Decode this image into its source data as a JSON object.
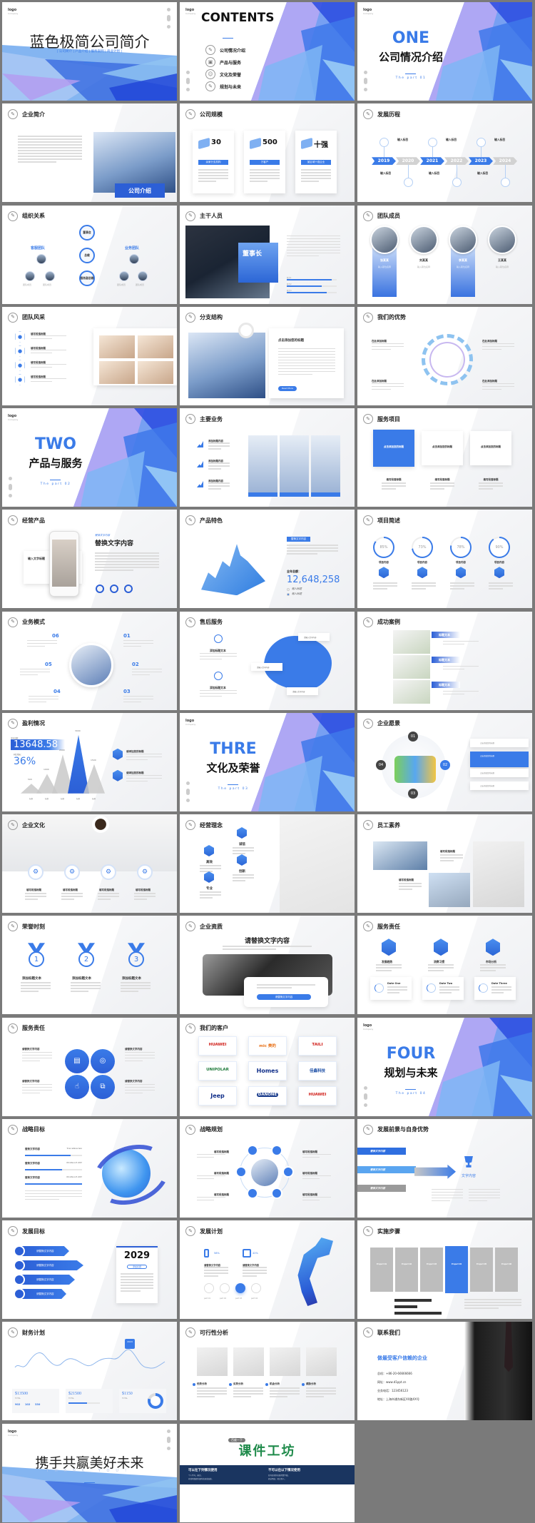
{
  "colors": {
    "accent": "#3a7be8",
    "accent_dark": "#2c5fd6",
    "bg": "#7a7a7a",
    "navy": "#1a3560",
    "green_title": "#1e8a4a"
  },
  "logo": {
    "text": "logo",
    "sub": "Company"
  },
  "slides": [
    {
      "type": "cover",
      "title": "蓝色极简公司简介",
      "subtitle": "| 公司简介 | 产品介绍 | 服务案例 | 商业计划 |"
    },
    {
      "type": "contents",
      "title": "CONTENTS",
      "items": [
        {
          "icon": "pencil-icon",
          "label": "公司情况介绍"
        },
        {
          "icon": "box-icon",
          "label": "产品与服务"
        },
        {
          "icon": "person-icon",
          "label": "文化及荣誉"
        },
        {
          "icon": "pencil-icon",
          "label": "规划与未来"
        }
      ]
    },
    {
      "type": "section",
      "num": "ONE",
      "title": "公司情况介绍",
      "part": "The part 01"
    },
    {
      "type": "intro",
      "header": "企业简介",
      "photo_label": "公司介绍"
    },
    {
      "type": "scale",
      "header": "公司规模",
      "cards": [
        {
          "value": "30",
          "label": "余家分支机构"
        },
        {
          "value": "500",
          "label": "万客户"
        },
        {
          "value": "十强",
          "label": "某区域十强企业"
        }
      ]
    },
    {
      "type": "timeline",
      "header": "发展历程",
      "years": [
        "2019",
        "2020",
        "2021",
        "2022",
        "2023",
        "2024"
      ],
      "item_label": "输入标目",
      "active": [
        true,
        false,
        true,
        false,
        true,
        false
      ]
    },
    {
      "type": "org",
      "header": "组织关系",
      "center": [
        "董事会",
        "总裁",
        "服务副总裁"
      ],
      "left_group": "客服团队",
      "right_group": "业务团队",
      "member": "团队成员"
    },
    {
      "type": "leader",
      "header": "主干人员",
      "role": "董事长",
      "bars": [
        {
          "label": "能力1",
          "value": 90
        },
        {
          "label": "能力2",
          "value": 70
        },
        {
          "label": "能力3",
          "value": 80
        }
      ]
    },
    {
      "type": "team",
      "header": "团队成员",
      "members": [
        {
          "name": "张某某",
          "role": "输入职位名称",
          "highlight": true
        },
        {
          "name": "刘某某",
          "role": "输入职位名称",
          "highlight": false
        },
        {
          "name": "李某某",
          "role": "输入职位名称",
          "highlight": true
        },
        {
          "name": "王某某",
          "role": "输入职位名称",
          "highlight": false
        }
      ]
    },
    {
      "type": "style",
      "header": "团队风采",
      "items": [
        "填写段落标题",
        "填写段落标题",
        "填写段落标题",
        "填写段落标题"
      ]
    },
    {
      "type": "branch",
      "header": "分支结构",
      "card_title": "点击添加您的标题",
      "button": "Read More"
    },
    {
      "type": "advantage",
      "header": "我们的优势",
      "items": [
        "在此添加标题",
        "在此添加标题",
        "在此添加标题",
        "在此添加标题"
      ]
    },
    {
      "type": "section",
      "num": "TWO",
      "title": "产品与服务",
      "part": "The part 02"
    },
    {
      "type": "business",
      "header": "主要业务",
      "items": [
        "添加标题内容",
        "添加标题内容",
        "添加标题内容"
      ]
    },
    {
      "type": "services",
      "header": "服务项目",
      "cards": [
        "点击添加您的标题",
        "点击添加您的标题",
        "点击添加您的标题"
      ],
      "bottom": [
        "填写段落标题",
        "填写段落标题",
        "填写段落标题"
      ]
    },
    {
      "type": "product",
      "header": "经营产品",
      "side_title": "输入文字标题",
      "kicker": "替换文字内容",
      "title": "替换文字内容"
    },
    {
      "type": "feature",
      "header": "产品特色",
      "tag": "替换文字内容",
      "total_label": "全年总额：",
      "total": "12,648,258",
      "legend": [
        "输入标题",
        "输入标题"
      ]
    },
    {
      "type": "project",
      "header": "项目简述",
      "rings": [
        {
          "value": 85,
          "label": "项目内容"
        },
        {
          "value": 73,
          "label": "项目内容"
        },
        {
          "value": 78,
          "label": "项目内容"
        },
        {
          "value": 90,
          "label": "项目内容"
        }
      ]
    },
    {
      "type": "model",
      "header": "业务模式",
      "nums": [
        "06",
        "01",
        "05",
        "02",
        "04",
        "03"
      ]
    },
    {
      "type": "aftersale",
      "header": "售后服务",
      "items": [
        "添加标题文本",
        "添加标题文本"
      ],
      "tags": [
        "请输入文字内容",
        "请输入文字内容",
        "请输入文字内容"
      ]
    },
    {
      "type": "cases",
      "header": "成功案例",
      "items": [
        "标题文本",
        "标题文本",
        "标题文本"
      ]
    },
    {
      "type": "profit",
      "header": "盈利情况",
      "total_label": "全年总额：",
      "total": "13648.58",
      "growth_label": "同比增长：",
      "growth": "36%",
      "peaks": [
        {
          "label": "500",
          "value": 500
        },
        {
          "label": "1000",
          "value": 1000
        },
        {
          "label": "2000",
          "value": 2000
        },
        {
          "label": "3000",
          "value": 3000
        },
        {
          "label": "1500",
          "value": 1500
        }
      ],
      "x_label": "标题",
      "notes": [
        "请添加您的标题",
        "请添加您的标题"
      ]
    },
    {
      "type": "section",
      "num": "THRE",
      "title": "文化及荣誉",
      "part": "The part 03"
    },
    {
      "type": "vision",
      "header": "企业愿景",
      "nums": [
        "01",
        "02",
        "03",
        "04"
      ],
      "list": [
        "点击添加您的标题",
        "点击添加您的标题",
        "点击添加您的标题",
        "点击添加您的标题"
      ]
    },
    {
      "type": "culture",
      "header": "企业文化",
      "items": [
        "填写段落标题",
        "填写段落标题",
        "填写段落标题",
        "填写段落标题"
      ]
    },
    {
      "type": "philosophy",
      "header": "经营理念",
      "items": [
        "诚信",
        "高效",
        "专业",
        "创新"
      ]
    },
    {
      "type": "staff",
      "header": "员工素养",
      "items": [
        "填写段落标题",
        "填写段落标题"
      ]
    },
    {
      "type": "honor",
      "header": "荣誉时刻",
      "medals": [
        {
          "n": "1",
          "label": "添加标题文本"
        },
        {
          "n": "2",
          "label": "添加标题文本"
        },
        {
          "n": "3",
          "label": "添加标题文本"
        }
      ]
    },
    {
      "type": "quality",
      "header": "企业资质",
      "title": "请替换文字内容",
      "button": "请替换文字内容"
    },
    {
      "type": "duty",
      "header": "服务责任",
      "items": [
        "发展趋势",
        "消费习惯",
        "市场分析"
      ],
      "dates": [
        "Date One",
        "Date Two",
        "Date Three"
      ]
    },
    {
      "type": "duty2",
      "header": "服务责任",
      "items": [
        "请替换文字内容",
        "请替换文字内容",
        "请替换文字内容",
        "请替换文字内容"
      ]
    },
    {
      "type": "clients",
      "header": "我们的客户",
      "logos": [
        "HUAWEI",
        "mic 美的",
        "TAILI",
        "UNIPOLAR",
        "Homes",
        "佳鑫科技",
        "Jeep",
        "DANONE",
        "HUAWEI"
      ]
    },
    {
      "type": "section",
      "num": "FOUR",
      "title": "规划与未来",
      "part": "The part 04"
    },
    {
      "type": "strategy",
      "header": "战略目标",
      "rows": [
        {
          "label": "替换文字内容",
          "value": "Your address here",
          "progress": 80
        },
        {
          "label": "替换文字内容",
          "value": "001.664.123 4567",
          "progress": 65
        },
        {
          "label": "替换文字内容",
          "value": "001.664.123 4567",
          "progress": 100
        }
      ]
    },
    {
      "type": "plan",
      "header": "战略规划",
      "items": [
        "填写段落标题",
        "填写段落标题",
        "填写段落标题",
        "填写段落标题",
        "填写段落标题",
        "填写段落标题"
      ]
    },
    {
      "type": "prospect",
      "header": "发展前景与自身优势",
      "arrows": [
        "替换文字内容",
        "替换文字内容",
        "替换文字内容"
      ],
      "trophy": "文字内容"
    },
    {
      "type": "goal",
      "header": "发展目标",
      "year": "2029",
      "tag": "添加标题",
      "items": [
        "请替换文字内容",
        "请替换文字内容",
        "请替换文字内容",
        "请替换文字内容"
      ]
    },
    {
      "type": "devplan",
      "header": "发展计划",
      "stats": [
        {
          "value": "58%",
          "label": "请替换文字内容"
        },
        {
          "value": "42%",
          "label": "请替换文字内容"
        }
      ],
      "parts": [
        "part 01",
        "part 02",
        "part 03",
        "part 04"
      ]
    },
    {
      "type": "steps",
      "header": "实施步骤",
      "steps": [
        "Project 01",
        "Project 02",
        "Project 03",
        "Project 04",
        "Project 05",
        "Project 06"
      ],
      "active": 3
    },
    {
      "type": "finance",
      "header": "财务计划",
      "marker": "2024",
      "cards": [
        {
          "value": "$13500",
          "sub": "TOTAL",
          "nums": [
            "902",
            "102",
            "330"
          ]
        },
        {
          "value": "$21500",
          "sub": "TOTAL",
          "progress": 60
        },
        {
          "value": "$1150",
          "sub": "TOTAL",
          "ring": 80
        }
      ]
    },
    {
      "type": "feasibility",
      "header": "可行性分析",
      "items": [
        "优势分析",
        "劣势分析",
        "机会分析",
        "威胁分析"
      ]
    },
    {
      "type": "contact",
      "header": "联系我们",
      "slogan": "做最受客户信赖的企业",
      "lines": [
        "总机：+86-20-66666666",
        "网址：www.d1ppt.cn",
        "业务电话：123456123",
        "地址：上海市浦东新区XX路XX号"
      ]
    },
    {
      "type": "thanks",
      "title": "携手共赢美好未来",
      "subtitle": "THANK YOU!"
    },
    {
      "type": "brand",
      "badge": "百度一下",
      "title": "课件工坊",
      "can_title": "可以在下列情况使用",
      "can": [
        "个人学习、研究。",
        "非营利组织内部的培训或演讲。"
      ],
      "cannot_title": "不可以在以下情况使用",
      "cannot": [
        "任何形式的在线付费下载。",
        "商业用途、转让他人。"
      ]
    }
  ]
}
